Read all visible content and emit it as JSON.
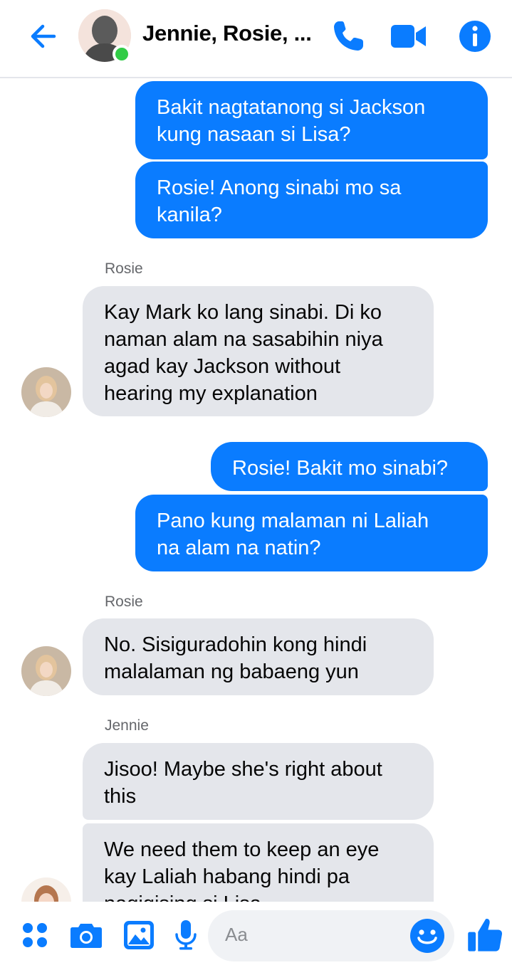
{
  "header": {
    "title": "Jennie, Rosie, ...",
    "icons": [
      "back-arrow-icon",
      "group-avatar",
      "phone-icon",
      "video-camera-icon",
      "info-icon"
    ]
  },
  "messages": [
    {
      "direction": "outgoing",
      "text": "Bakit nagtatanong si Jackson\nkung nasaan si Lisa?"
    },
    {
      "direction": "outgoing",
      "text": "Rosie! Anong sinabi mo sa\nkanila?"
    },
    {
      "direction": "incoming",
      "sender": "Rosie",
      "text": "Kay Mark ko lang sinabi. Di ko\nnaman alam na sasabihin niya\nagad kay Jackson without\nhearing my explanation"
    },
    {
      "direction": "outgoing",
      "text": "Rosie! Bakit mo sinabi?"
    },
    {
      "direction": "outgoing",
      "text": "Pano kung malaman ni Laliah\nna alam na natin?"
    },
    {
      "direction": "incoming",
      "sender": "Rosie",
      "text": "No. Sisiguradohin kong hindi\nmalalaman ng babaeng yun"
    },
    {
      "direction": "incoming",
      "sender": "Jennie",
      "text": "Jisoo! Maybe she's right about\nthis"
    },
    {
      "direction": "incoming",
      "text": "We need them to keep an eye\nkay Laliah habang hindi pa\nnagigising si Lisa"
    }
  ],
  "composer": {
    "placeholder": "Aa",
    "icons": [
      "apps-icon",
      "camera-icon",
      "gallery-icon",
      "microphone-icon",
      "emoji-icon",
      "thumbs-up-icon"
    ]
  },
  "colors": {
    "accent": "#0a7cff",
    "incoming_bubble": "#e4e6eb",
    "online": "#31cc46"
  }
}
